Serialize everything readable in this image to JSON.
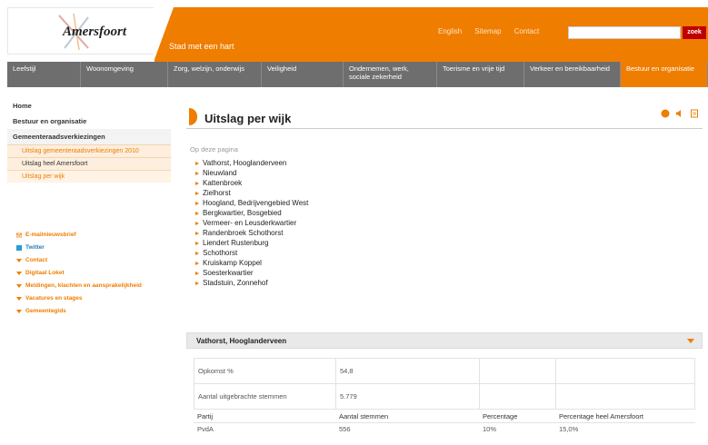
{
  "header": {
    "logo_text": "Amersfoort",
    "tagline": "Stad met een hart",
    "links": [
      "English",
      "Sitemap",
      "Contact"
    ],
    "search_placeholder": "",
    "search_button": "zoek",
    "accent_color": "#ef7d00"
  },
  "nav": {
    "items": [
      {
        "label": "Leefstijl"
      },
      {
        "label": "Woonomgeving"
      },
      {
        "label": "Zorg, welzijn, onderwijs"
      },
      {
        "label": "Veiligheid"
      },
      {
        "label": "Ondernemen, werk, sociale zekerheid"
      },
      {
        "label": "Toerisme en vrije tijd"
      },
      {
        "label": "Verkeer en bereikbaarheid"
      },
      {
        "label": "Bestuur en organisatie"
      }
    ]
  },
  "sidebar": {
    "home": "Home",
    "section": "Bestuur en organisatie",
    "subsection": "Gemeenteraadsverkiezingen",
    "items": [
      {
        "label": "Uitslag gemeenteraadsverkiezingen 2010"
      },
      {
        "label": "Uitslag heel Amersfoort"
      },
      {
        "label": "Uitslag per wijk"
      }
    ],
    "links": [
      {
        "label": "E-mailnieuwsbrief",
        "icon": "envelope-icon"
      },
      {
        "label": "Twitter",
        "icon": "twitter-icon"
      },
      {
        "label": "Contact",
        "icon": "arrow-icon"
      },
      {
        "label": "Digitaal Loket",
        "icon": "arrow-icon"
      },
      {
        "label": "Meldingen, klachten en aansprakelijkheid",
        "icon": "arrow-icon"
      },
      {
        "label": "Vacatures en stages",
        "icon": "arrow-icon"
      },
      {
        "label": "Gemeentegids",
        "icon": "arrow-icon"
      }
    ]
  },
  "main": {
    "title": "Uitslag per wijk",
    "on_this_page": "Op deze pagina",
    "toc": [
      "Vathorst, Hooglanderveen",
      "Nieuwland",
      "Kattenbroek",
      "Zielhorst",
      "Hoogland, Bedrijvengebied West",
      "Bergkwartier, Bosgebied",
      "Vermeer- en Leusderkwartier",
      "Randenbroek Schothorst",
      "Liendert Rustenburg",
      "Schothorst",
      "Kruiskamp Koppel",
      "Soesterkwartier",
      "Stadstuin, Zonnehof"
    ],
    "accordion_title": "Vathorst, Hooglanderveen",
    "stats": [
      {
        "label": "Opkomst %",
        "value": "54,8"
      },
      {
        "label": "Aantal uitgebrachte stemmen",
        "value": "5.779"
      }
    ],
    "results_header": [
      "Partij",
      "Aantal stemmen",
      "Percentage",
      "Percentage heel Amersfoort"
    ],
    "results_rows": [
      [
        "PvdA",
        "556",
        "10%",
        "15,0%"
      ]
    ]
  }
}
